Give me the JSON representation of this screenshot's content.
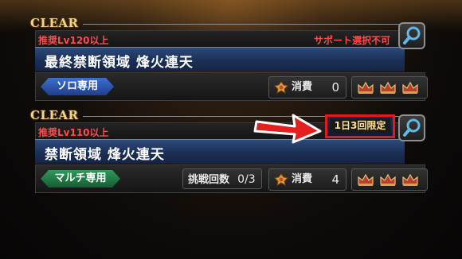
{
  "quests": [
    {
      "clear": "CLEAR",
      "recommended_level": "推奨Lv120以上",
      "support_note": "サポート選択不可",
      "title": "最終禁断領域 烽火連天",
      "mode": "ソロ専用",
      "cost_label": "消費",
      "cost_value": "0",
      "crowns": [
        "crown-icon",
        "crown-icon",
        "crown-icon"
      ]
    },
    {
      "clear": "CLEAR",
      "recommended_level": "推奨Lv110以上",
      "limit_badge": "1日3回限定",
      "title": "禁断領域 烽火連天",
      "mode": "マルチ専用",
      "attempts_label": "挑戦回数",
      "attempts_value": "0/3",
      "cost_label": "消費",
      "cost_value": "4",
      "crowns": [
        "crown-icon",
        "crown-icon",
        "crown-icon"
      ]
    }
  ],
  "colors": {
    "accent_red": "#e11b1b",
    "title_blue": "#1b2f55",
    "clear_gold": "#f2d48a",
    "solo_blue": "#3d6fd0",
    "multi_green": "#2f9a5c"
  }
}
